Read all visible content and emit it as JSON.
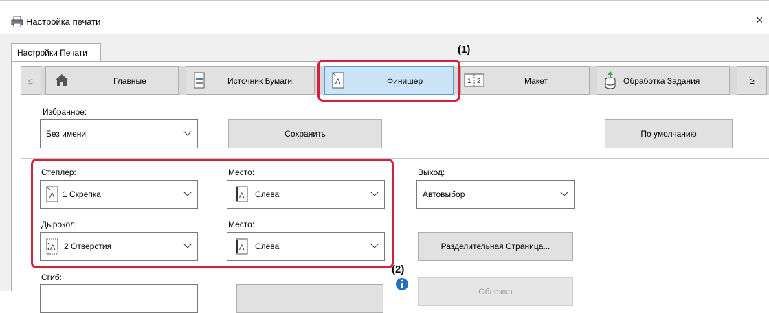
{
  "window": {
    "title": "Настройка печати",
    "close_glyph": "×"
  },
  "tabs": [
    {
      "label": "Настройки Печати"
    }
  ],
  "nav": {
    "prev_label": "≤",
    "next_label": "≥",
    "items": [
      {
        "label": "Главные",
        "icon": "home-icon"
      },
      {
        "label": "Источник Бумаги",
        "icon": "paper-tray-icon"
      },
      {
        "label": "Финишер",
        "icon": "finisher-icon",
        "selected": true
      },
      {
        "label": "Макет",
        "icon": "layout-icon"
      },
      {
        "label": "Обработка Задания",
        "icon": "job-handling-icon"
      }
    ]
  },
  "annotations": {
    "a1": "(1)",
    "a2": "(2)"
  },
  "favorites": {
    "label": "Избранное:",
    "value": "Без имени",
    "save": "Сохранить",
    "default": "По умолчанию"
  },
  "staple": {
    "label": "Степлер:",
    "value": "1 Скрепка"
  },
  "staple_place": {
    "label": "Место:",
    "value": "Слева"
  },
  "output": {
    "label": "Выход:",
    "value": "Автовыбор"
  },
  "punch": {
    "label": "Дырокол:",
    "value": "2 Отверстия"
  },
  "punch_place": {
    "label": "Место:",
    "value": "Слева"
  },
  "separator_button": "Разделительная Страница...",
  "fold": {
    "label": "Сгиб:"
  },
  "disabled_button": "Обложка",
  "colors": {
    "accent_red": "#d4203a",
    "selected_tab": "#cce4f7",
    "info_blue": "#1f6fc5"
  }
}
